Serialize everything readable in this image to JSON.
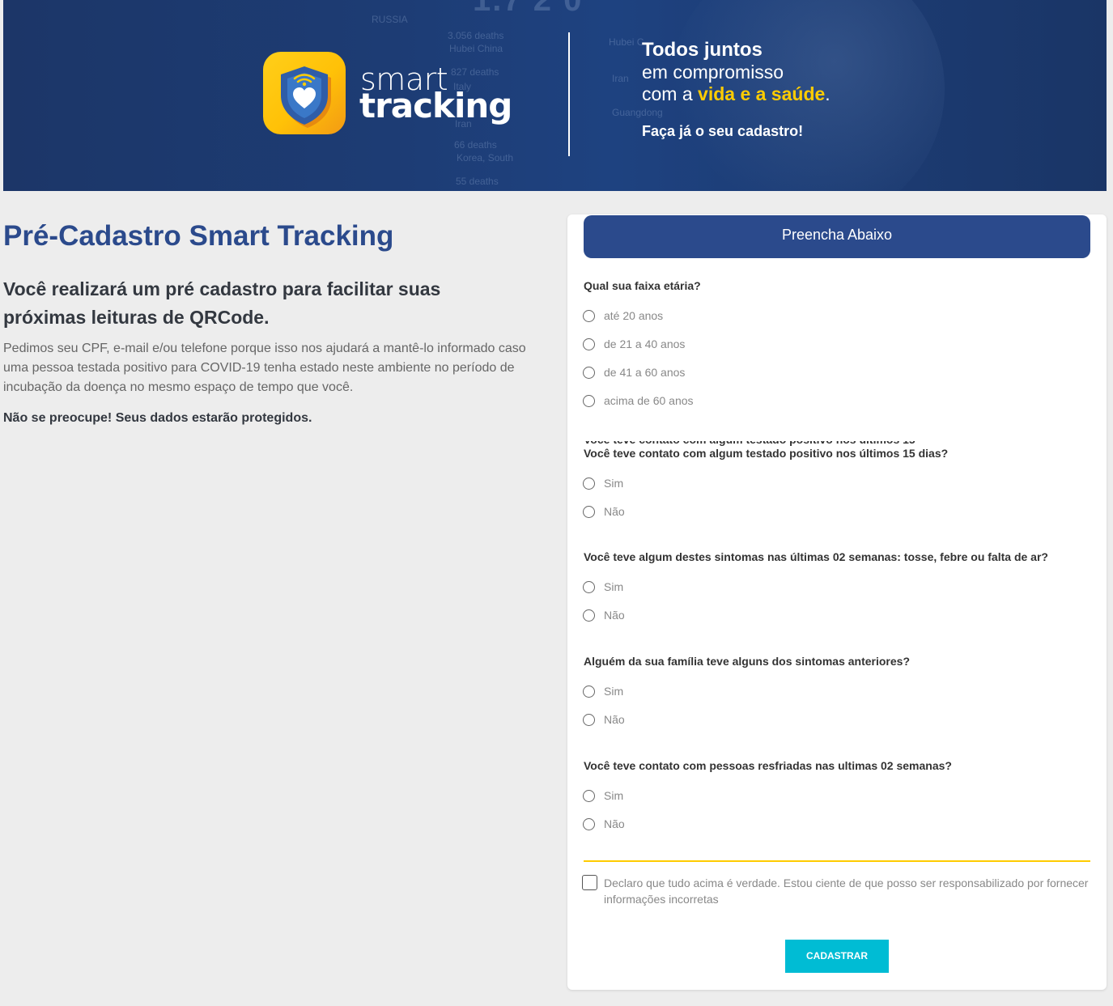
{
  "banner": {
    "bg_big": "1.7 2 0",
    "bg_labels": [
      "RUSSIA",
      "3.056 deaths",
      "Hubei China",
      "827 deaths",
      "Italy",
      "Iran",
      "66 deaths",
      "Korea, South",
      "55 deaths",
      "Hubei C",
      "Iran",
      "Guangdong"
    ],
    "brand_smart": "smart",
    "brand_tracking": "tracking",
    "tagline_1": "Todos juntos",
    "tagline_2": "em compromisso",
    "tagline_3_prefix": "com a ",
    "tagline_3_highlight": "vida e a saúde",
    "tagline_3_suffix": ".",
    "tagline_4": "Faça já o seu cadastro!",
    "colors": {
      "highlight": "#ffcc00",
      "logo": "#ffc107"
    }
  },
  "left": {
    "title": "Pré-Cadastro Smart Tracking",
    "subtitle": "Você realizará um pré cadastro para facilitar suas próximas leituras de QRCode.",
    "description": "Pedimos seu CPF, e-mail e/ou telefone porque isso nos ajudará a mantê-lo informado caso uma pessoa testada positivo para COVID-19 tenha estado neste ambiente no período de incubação da doença no mesmo espaço de tempo que você.",
    "reassurance": "Não se preocupe! Seus dados estarão protegidos."
  },
  "form": {
    "header": "Preencha Abaixo",
    "questions": [
      {
        "label": "Qual sua faixa etária?",
        "options": [
          "até 20 anos",
          "de 21 a 40 anos",
          "de 41 a 60 anos",
          "acima de 60 anos"
        ]
      },
      {
        "label": "Você teve contato com algum testado positivo nos últimos 15 dias?",
        "options": [
          "Sim",
          "Não"
        ]
      },
      {
        "label": "Você teve algum destes sintomas nas últimas 02 semanas: tosse, febre ou falta de ar?",
        "options": [
          "Sim",
          "Não"
        ]
      },
      {
        "label": "Alguém da sua família teve alguns dos sintomas anteriores?",
        "options": [
          "Sim",
          "Não"
        ]
      },
      {
        "label": "Você teve contato com pessoas resfriadas nas ultimas 02 semanas?",
        "options": [
          "Sim",
          "Não"
        ]
      }
    ],
    "declaration": "Declaro que tudo acima é verdade. Estou ciente de que posso ser responsabilizado por fornecer informações incorretas",
    "submit_label": "CADASTRAR",
    "colors": {
      "header": "#2b4a8c",
      "separator": "#ffcc00",
      "submit": "#00bcd4"
    }
  }
}
